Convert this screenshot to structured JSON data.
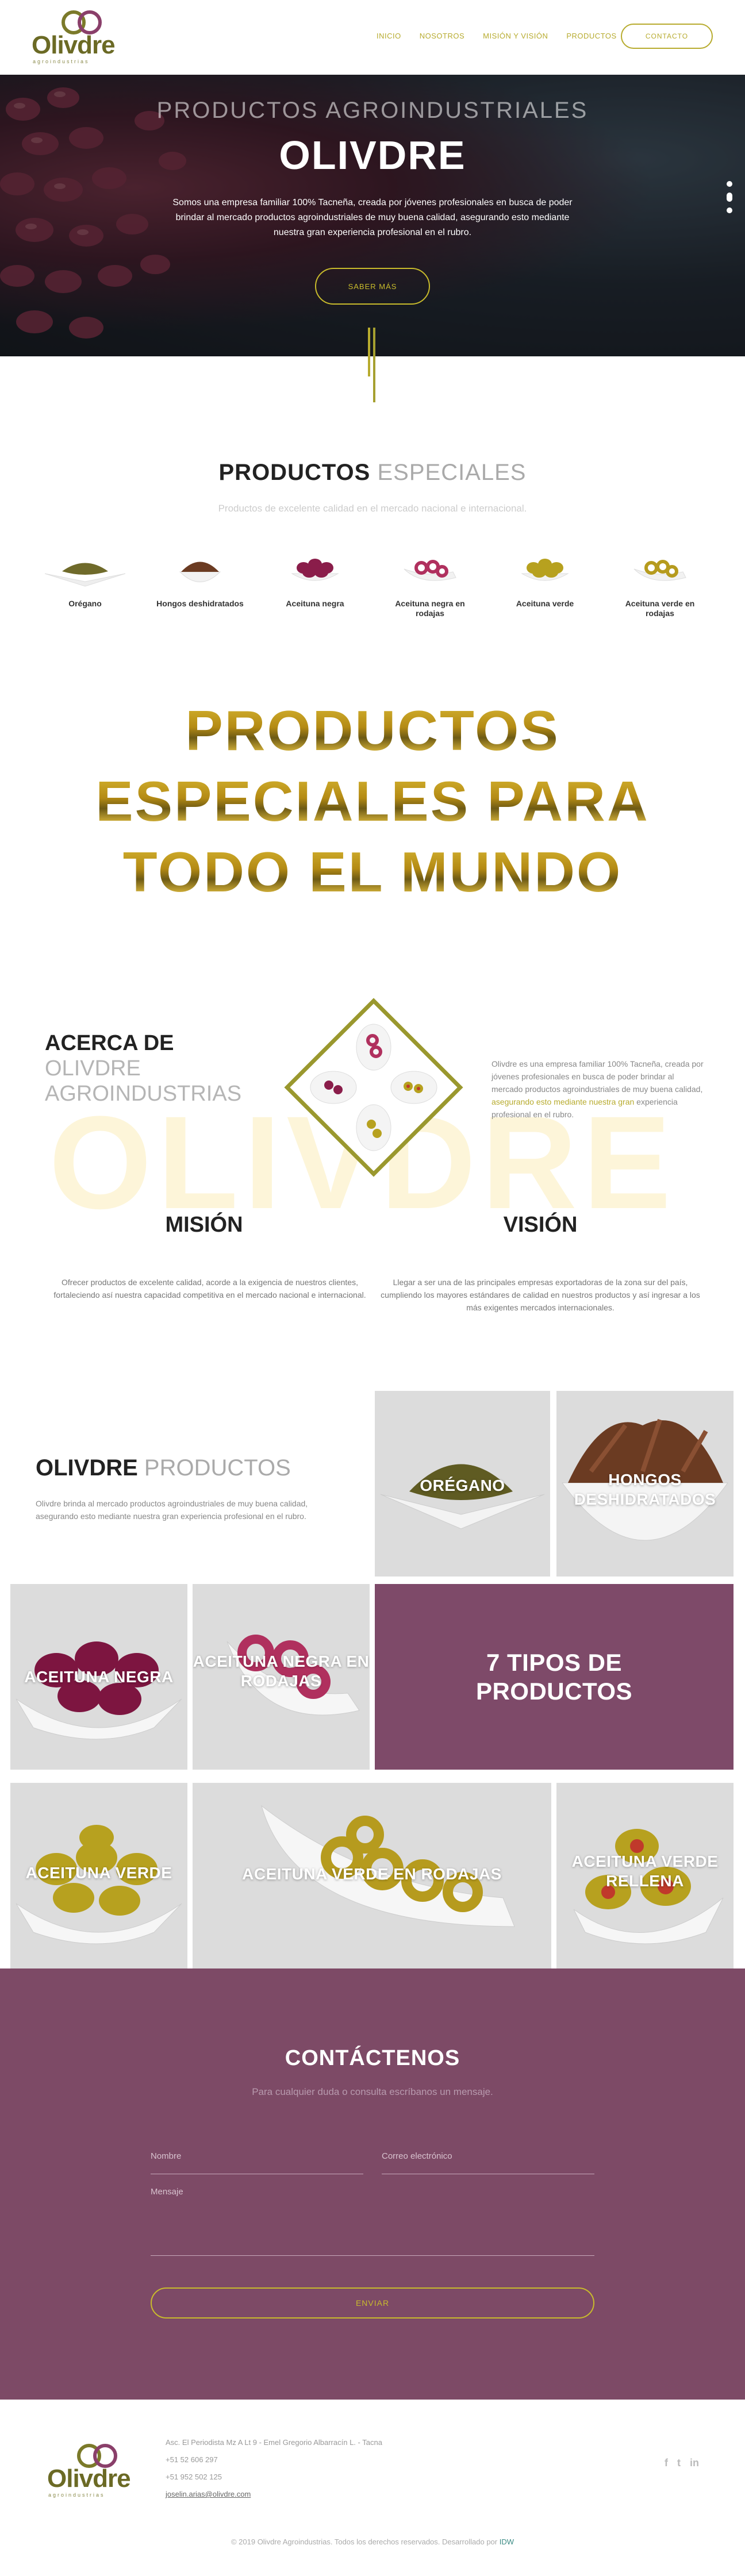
{
  "header": {
    "logo": {
      "word": "Olivdre",
      "sub": "agroindustrias"
    },
    "nav": [
      {
        "label": "INICIO"
      },
      {
        "label": "NOSOTROS"
      },
      {
        "label": "MISIÓN Y VISIÓN"
      },
      {
        "label": "PRODUCTOS"
      }
    ],
    "cta": "CONTACTO"
  },
  "hero": {
    "subtitle": "PRODUCTOS AGROINDUSTRIALES",
    "title": "OLIVDRE",
    "text": "Somos una empresa familiar 100% Tacneña, creada por jóvenes profesionales en busca de poder brindar al mercado productos agroindustriales de muy buena calidad, asegurando esto mediante nuestra gran experiencia profesional en el rubro.",
    "button": "SABER MÁS"
  },
  "special": {
    "title_bold": "PRODUCTOS",
    "title_light": "ESPECIALES",
    "subtitle": "Productos de excelente calidad en el mercado nacional e internacional.",
    "items": [
      {
        "label": "Orégano",
        "color": "#6f6a2a"
      },
      {
        "label": "Hongos deshidratados",
        "color": "#6b3b22"
      },
      {
        "label": "Aceituna negra",
        "color": "#8a1d4a"
      },
      {
        "label": "Aceituna negra en rodajas",
        "color": "#b0305e"
      },
      {
        "label": "Aceituna verde",
        "color": "#b7a11f"
      },
      {
        "label": "Aceituna verde en rodajas",
        "color": "#b69b1e"
      }
    ]
  },
  "banner": {
    "lines": [
      "PRODUCTOS",
      "ESPECIALES PARA",
      "TODO EL MUNDO"
    ]
  },
  "about": {
    "title_bold": "ACERCA DE",
    "title_light_1": "OLIVDRE",
    "title_light_2": "AGROINDUSTRIAS",
    "watermark": "OLIVDRE",
    "text_a": "Olivdre es una empresa familiar 100% Tacneña, creada por jóvenes profesionales en busca de poder brindar al mercado productos agroindustriales de muy buena calidad,",
    "text_highlight": "asegurando esto mediante nuestra gran",
    "text_b": "experiencia profesional en el rubro.",
    "mission_title": "MISIÓN",
    "mission_text": "Ofrecer productos de excelente calidad, acorde a la exigencia de nuestros clientes, fortaleciendo así nuestra capacidad competitiva en el mercado nacional e internacional.",
    "vision_title": "VISIÓN",
    "vision_text": "Llegar a ser una de las principales empresas exportadoras de la zona sur del país, cumpliendo los mayores estándares de calidad en nuestros productos y así ingresar a los más exigentes mercados internacionales."
  },
  "products": {
    "title_bold": "OLIVDRE",
    "title_light": "PRODUCTOS",
    "text": "Olivdre brinda al mercado productos agroindustriales de muy buena calidad, asegurando esto mediante nuestra gran experiencia profesional en el rubro.",
    "tiles": {
      "oregano": "ORÉGANO",
      "hongos": "HONGOS DESHIDRATADOS",
      "negra": "ACEITUNA NEGRA",
      "negra_rodajas": "ACEITUNA NEGRA EN RODAJAS",
      "tipos": "7 TIPOS DE PRODUCTOS",
      "verde": "ACEITUNA VERDE",
      "verde_rodajas": "ACEITUNA VERDE EN RODAJAS",
      "verde_rellena": "ACEITUNA VERDE RELLENA"
    }
  },
  "contact": {
    "title": "CONTÁCTENOS",
    "lead": "Para cualquier duda o consulta escríbanos un mensaje.",
    "name_placeholder": "Nombre",
    "email_placeholder": "Correo electrónico",
    "message_placeholder": "Mensaje",
    "send": "ENVIAR"
  },
  "footer": {
    "address": "Asc. El Periodista Mz A Lt 9 - Emel Gregorio Albarracín L. - Tacna",
    "phone1": "+51 52 606 297",
    "phone2": "+51 952 502 125",
    "email": "joselin.arias@olivdre.com",
    "social": [
      "f",
      "t",
      "in"
    ],
    "copyright": "© 2019 Olivdre Agroindustrias. Todos los derechos reservados. Desarrollado por",
    "dev": "IDW"
  },
  "colors": {
    "olive": "#b7ab2e",
    "purple": "#7d4a66",
    "dark_olive": "#6b6a25"
  }
}
